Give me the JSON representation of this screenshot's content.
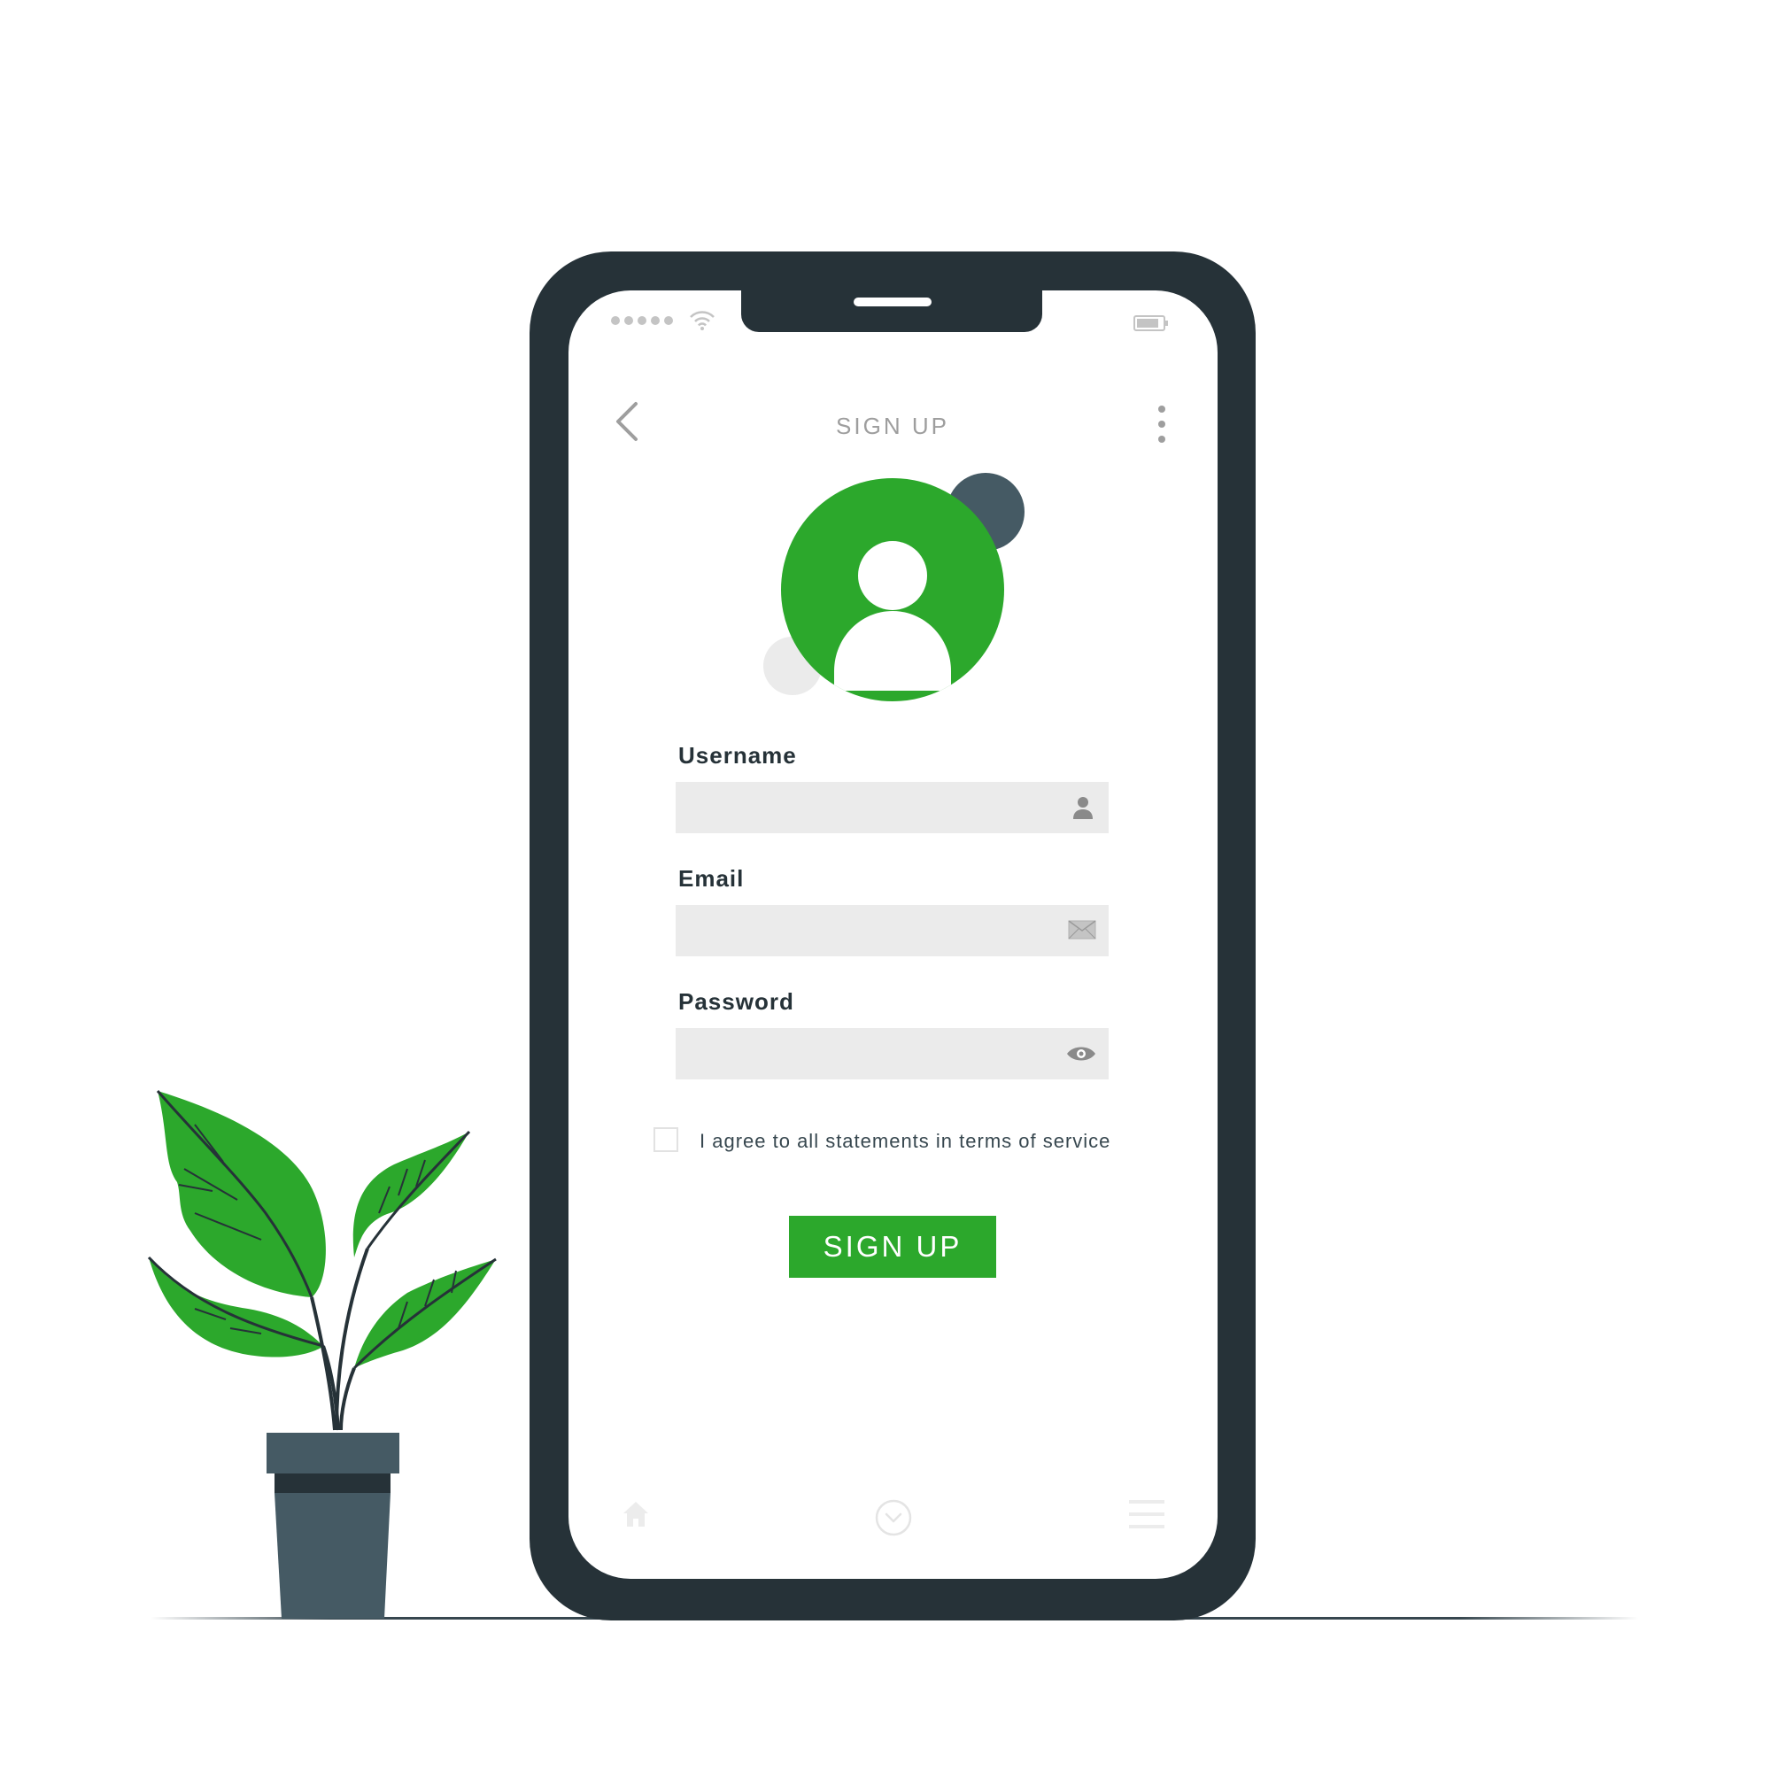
{
  "screen": {
    "title": "SIGN UP"
  },
  "icons": {
    "back": "chevron-left-icon",
    "more": "vertical-dots-icon",
    "avatar": "user-avatar-icon",
    "username": "user-icon",
    "email": "envelope-icon",
    "password": "eye-icon",
    "home": "home-icon",
    "center": "chevron-down-circle-icon",
    "menu": "hamburger-menu-icon",
    "wifi": "wifi-icon",
    "battery": "battery-icon"
  },
  "form": {
    "username": {
      "label": "Username",
      "value": "",
      "placeholder": ""
    },
    "email": {
      "label": "Email",
      "value": "",
      "placeholder": ""
    },
    "password": {
      "label": "Password",
      "value": "",
      "placeholder": ""
    },
    "terms": {
      "label": "I agree to all statements in terms of service",
      "checked": false
    },
    "submit_label": "SIGN UP"
  },
  "colors": {
    "accent": "#2ca82c",
    "phone_frame": "#263238",
    "secondary_dark": "#455a64",
    "field_bg": "#ebebeb",
    "muted_text": "#9e9e9e"
  }
}
